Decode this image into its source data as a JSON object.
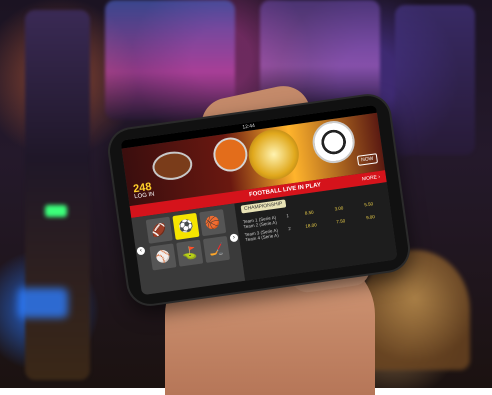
{
  "phone": {
    "status_time": "12:44",
    "banner": {
      "jackpot_number": "248",
      "login_label": "LOG IN",
      "cta_label": "NOW"
    },
    "red_bar": {
      "headline": "FOOTBALL LIVE IN PLAY",
      "more_label": "MORE ›"
    },
    "sport_tiles": [
      "🏈",
      "⚽",
      "🏀",
      "⚾",
      "⛳",
      "🏒"
    ],
    "tab_label": "CHAMPIONSHIP",
    "matches": [
      {
        "team_a": "Team 1 (Serie A)",
        "team_b": "Team 2 (Serie A)",
        "sep": "1",
        "odds": [
          "8.50",
          "3.00",
          "5.50"
        ]
      },
      {
        "team_a": "Team 3 (Serie A)",
        "team_b": "Team 4 (Serie A)",
        "sep": "2",
        "odds": [
          "18.00",
          "7.50",
          "9.00"
        ]
      }
    ]
  }
}
